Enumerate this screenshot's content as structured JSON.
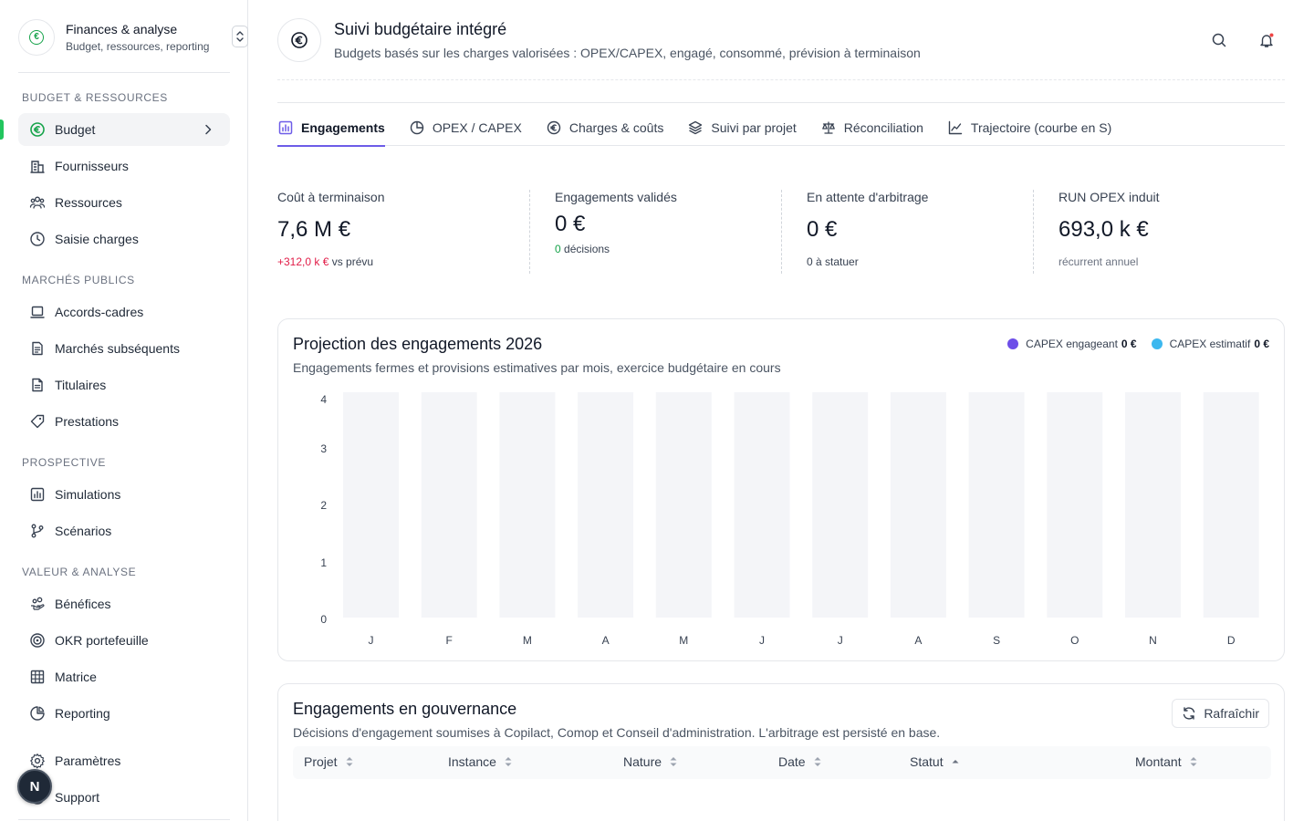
{
  "workspace": {
    "title": "Finances & analyse",
    "subtitle": "Budget, ressources, reporting"
  },
  "sidebar": {
    "sections": [
      {
        "label": "BUDGET & RESSOURCES"
      },
      {
        "label": "MARCHÉS PUBLICS"
      },
      {
        "label": "PROSPECTIVE"
      },
      {
        "label": "VALEUR & ANALYSE"
      }
    ],
    "items": [
      {
        "label": "Budget",
        "icon": "euro-circle-icon",
        "active": true
      },
      {
        "label": "Fournisseurs",
        "icon": "building-icon"
      },
      {
        "label": "Ressources",
        "icon": "users-icon"
      },
      {
        "label": "Saisie charges",
        "icon": "clock-icon"
      },
      {
        "label": "Accords-cadres",
        "icon": "laptop-icon"
      },
      {
        "label": "Marchés subséquents",
        "icon": "document-list-icon"
      },
      {
        "label": "Titulaires",
        "icon": "document-icon"
      },
      {
        "label": "Prestations",
        "icon": "tag-icon"
      },
      {
        "label": "Simulations",
        "icon": "bar-chart-icon"
      },
      {
        "label": "Scénarios",
        "icon": "git-branch-icon"
      },
      {
        "label": "Bénéfices",
        "icon": "hand-coins-icon"
      },
      {
        "label": "OKR portefeuille",
        "icon": "target-icon"
      },
      {
        "label": "Matrice",
        "icon": "grid-icon"
      },
      {
        "label": "Reporting",
        "icon": "pie-chart-icon"
      },
      {
        "label": "Paramètres",
        "icon": "gear-icon"
      },
      {
        "label": "Support",
        "icon": "help-icon"
      }
    ],
    "avatar_letter": "N"
  },
  "header": {
    "title": "Suivi budgétaire intégré",
    "subtitle": "Budgets basés sur les charges valorisées : OPEX/CAPEX, engagé, consommé, prévision à terminaison"
  },
  "tabs": [
    {
      "label": "Engagements",
      "icon": "bar-chart-icon",
      "active": true
    },
    {
      "label": "OPEX / CAPEX",
      "icon": "pie-chart-icon"
    },
    {
      "label": "Charges & coûts",
      "icon": "euro-circle-icon"
    },
    {
      "label": "Suivi par projet",
      "icon": "layers-icon"
    },
    {
      "label": "Réconciliation",
      "icon": "scale-icon"
    },
    {
      "label": "Trajectoire (courbe en S)",
      "icon": "line-chart-icon"
    }
  ],
  "kpis": [
    {
      "label": "Coût à terminaison",
      "value": "7,6 M €",
      "note_highlight": "+312,0 k €",
      "note_rest": " vs prévu"
    },
    {
      "label": "Engagements validés",
      "value": "0 €",
      "note_highlight": "0",
      "note_rest": " décisions"
    },
    {
      "label": "En attente d'arbitrage",
      "value": "0 €",
      "note_highlight": "",
      "note_rest": "0 à statuer"
    },
    {
      "label": "RUN OPEX induit",
      "value": "693,0 k €",
      "note_highlight": "",
      "note_rest": "récurrent annuel"
    }
  ],
  "projection_card": {
    "title": "Projection des engagements 2026",
    "subtitle": "Engagements fermes et provisions estimatives par mois, exercice budgétaire en cours",
    "legend": [
      {
        "name": "CAPEX engageant",
        "value": "0 €",
        "color": "#6d4ee8"
      },
      {
        "name": "CAPEX estimatif",
        "value": "0 €",
        "color": "#3cb8ef"
      }
    ]
  },
  "chart_data": {
    "type": "bar",
    "title": "Projection des engagements 2026",
    "categories": [
      "J",
      "F",
      "M",
      "A",
      "M",
      "J",
      "J",
      "A",
      "S",
      "O",
      "N",
      "D"
    ],
    "series": [
      {
        "name": "CAPEX engageant",
        "values": [
          0,
          0,
          0,
          0,
          0,
          0,
          0,
          0,
          0,
          0,
          0,
          0
        ]
      },
      {
        "name": "CAPEX estimatif",
        "values": [
          0,
          0,
          0,
          0,
          0,
          0,
          0,
          0,
          0,
          0,
          0,
          0
        ]
      }
    ],
    "yticks": [
      "0",
      "1",
      "2",
      "3",
      "4"
    ],
    "ylim": [
      0,
      4
    ],
    "xlabel": "",
    "ylabel": "",
    "grid": false,
    "legend_position": "top-right",
    "colors": {
      "engageant": "#6d4ee8",
      "estimatif": "#3cb8ef",
      "empty_bar": "#f4f5f8"
    }
  },
  "governance_card": {
    "title": "Engagements en gouvernance",
    "subtitle": "Décisions d'engagement soumises à Copilact, Comop et Conseil d'administration. L'arbitrage est persisté en base.",
    "refresh_label": "Rafraîchir",
    "columns": [
      "Projet",
      "Instance",
      "Nature",
      "Date",
      "Statut",
      "Montant"
    ]
  },
  "colors": {
    "accent": "#6d5ce8",
    "brand_green": "#16a34a",
    "negative": "#e11d48"
  }
}
